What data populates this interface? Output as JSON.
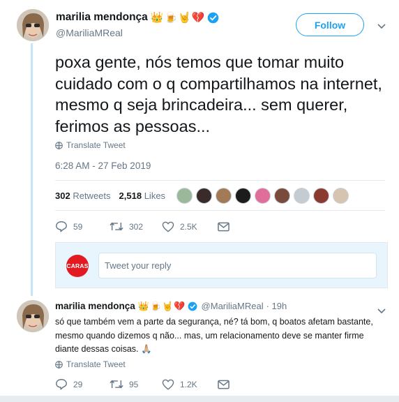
{
  "main_tweet": {
    "display_name": "marilia mendonça",
    "name_emojis": [
      "👑",
      "🍺",
      "🤘",
      "💔"
    ],
    "handle": "@MariliaMReal",
    "follow_label": "Follow",
    "text": "poxa gente, nós temos que tomar muito cuidado com o q compartilhamos na internet, mesmo q seja brincadeira... sem querer, ferimos as pessoas...",
    "translate_label": "Translate Tweet",
    "timestamp": "6:28 AM - 27 Feb 2019",
    "retweets_count": "302",
    "retweets_label": "Retweets",
    "likes_count": "2,518",
    "likes_label": "Likes",
    "actions": {
      "replies": "59",
      "retweets": "302",
      "likes": "2.5K"
    }
  },
  "reply_box": {
    "logo_text": "CARAS",
    "placeholder": "Tweet your reply"
  },
  "reply_tweet": {
    "display_name": "marilia mendonça",
    "name_emojis": [
      "👑",
      "🍺",
      "🤘",
      "💔"
    ],
    "handle": "@MariliaMReal",
    "time": "· 19h",
    "text": "só que também vem a parte da segurança, né? tá bom, q boatos afetam bastante, mesmo quando dizemos q não... mas, um relacionamento deve se manter firme diante dessas coisas. 🙏🏼",
    "translate_label": "Translate Tweet",
    "actions": {
      "replies": "29",
      "retweets": "95",
      "likes": "1.2K"
    }
  },
  "colors": {
    "accent": "#1da1f2",
    "muted": "#657786",
    "thread_line": "#c4e6f9",
    "reply_bg": "#e8f5fd"
  }
}
